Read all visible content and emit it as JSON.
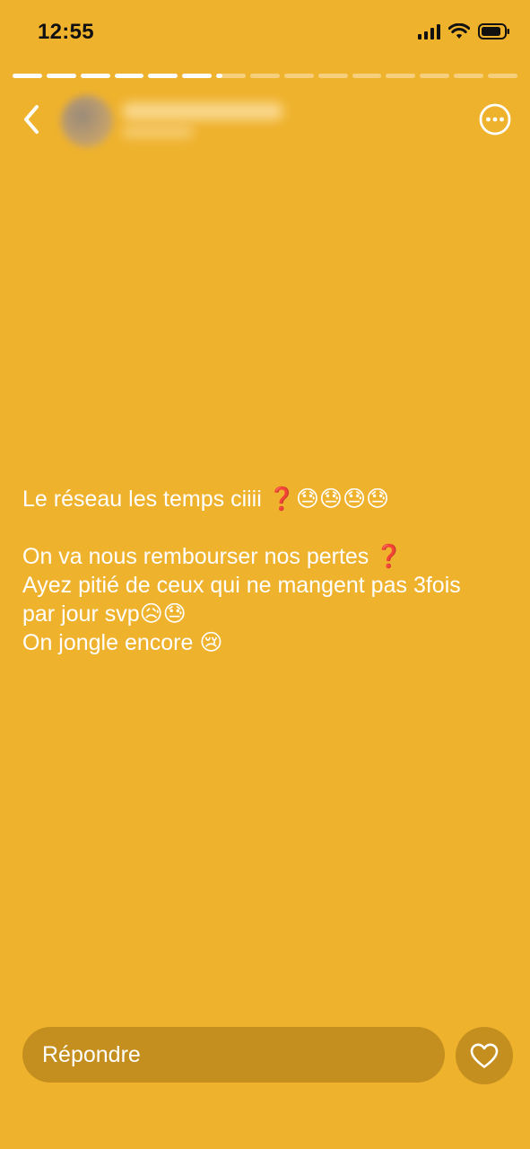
{
  "status_bar": {
    "time": "12:55",
    "icons": [
      "cellular-signal-icon",
      "wifi-icon",
      "battery-icon"
    ]
  },
  "story_progress": {
    "segments_total": 15,
    "segments_completed": 6,
    "current_segment_progress": 0.2
  },
  "header": {
    "back_icon": "chevron-left-icon",
    "more_icon": "ellipsis-circle-icon"
  },
  "message": {
    "line1": "Le réseau les temps ciiii ❓😓😓😓😓",
    "line2": "On va nous rembourser nos pertes ❓",
    "line3": "Ayez pitié de ceux qui ne mangent pas 3fois",
    "line4": "par jour svp😥😓",
    "line5": "On jongle encore 😢"
  },
  "reply": {
    "placeholder": "Répondre",
    "like_icon": "heart-outline-icon"
  },
  "colors": {
    "background": "#EFB22D",
    "input_background": "#C48F1E",
    "text": "#FFFFFF"
  }
}
